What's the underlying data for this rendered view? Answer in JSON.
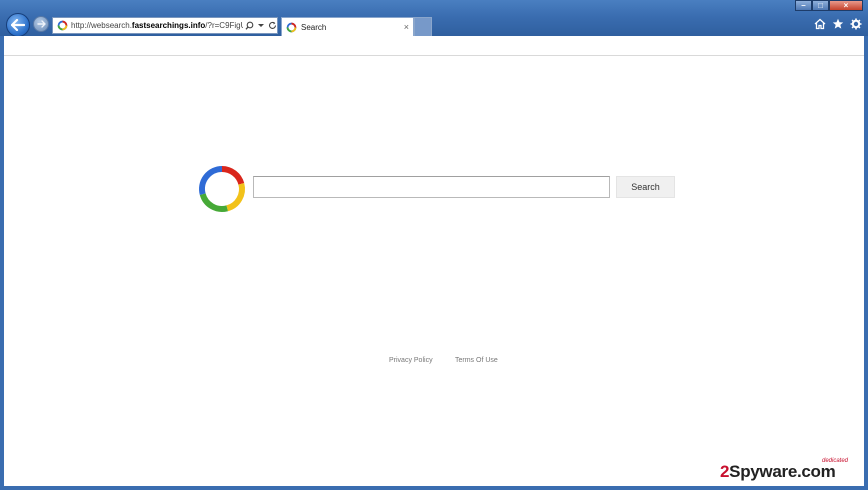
{
  "browser": {
    "address_prefix": "http://websearch.",
    "address_domain": "fastsearchings.info",
    "address_suffix": "/?r=C9FigU7l",
    "tab_label": "Search",
    "tab_close": "×",
    "minimize": "–",
    "maximize": "□",
    "close": "×"
  },
  "page": {
    "search_button": "Search",
    "search_placeholder": "",
    "privacy_policy": "Privacy Policy",
    "terms_of_use": "Terms Of Use"
  },
  "watermark": {
    "number": "2",
    "text": "Spyware.com",
    "tag": "dedicated"
  },
  "colors": {
    "logo_red": "#d9261c",
    "logo_yellow": "#f2c21a",
    "logo_green": "#46a937",
    "logo_blue": "#2f6bd6",
    "chrome_blue": "#3a6db0"
  },
  "icons": [
    "back-arrow-icon",
    "forward-arrow-icon",
    "page-favicon",
    "search-icon",
    "dropdown-icon",
    "refresh-icon",
    "home-icon",
    "favorites-star-icon",
    "settings-gear-icon"
  ]
}
